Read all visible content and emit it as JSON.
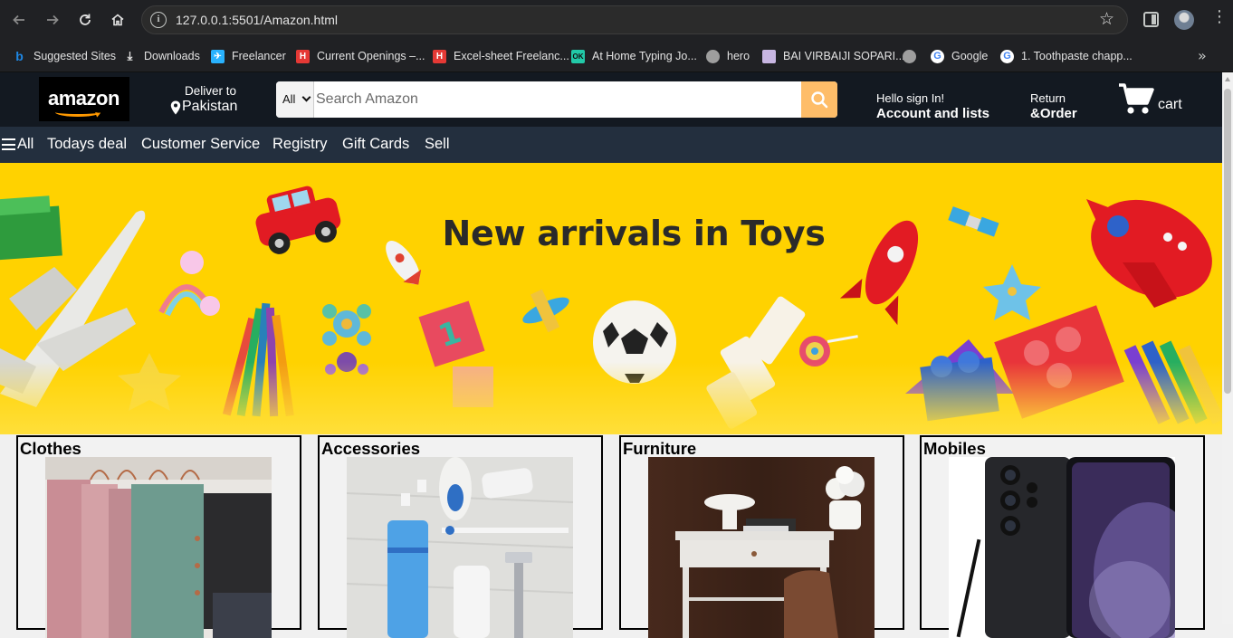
{
  "browser": {
    "url": "127.0.0.1:5501/Amazon.html",
    "back_icon": "arrow-left-icon",
    "forward_icon": "arrow-right-icon",
    "reload_icon": "reload-icon",
    "home_icon": "home-icon"
  },
  "bookmarks": [
    {
      "label": "Suggested Sites",
      "icon": "bing-icon",
      "color": "#1e88e5"
    },
    {
      "label": "Downloads",
      "icon": "download-icon",
      "color": "#e3e3e3"
    },
    {
      "label": "Freelancer",
      "icon": "freelancer-icon",
      "color": "#29b2fe"
    },
    {
      "label": "Current Openings –...",
      "icon": "h-icon",
      "color": "#e53935"
    },
    {
      "label": "Excel-sheet Freelanc...",
      "icon": "h-icon",
      "color": "#e53935"
    },
    {
      "label": "At Home Typing Jo...",
      "icon": "ok-icon",
      "color": "#22c9a8"
    },
    {
      "label": "hero",
      "icon": "globe-icon",
      "color": "#9e9e9e"
    },
    {
      "label": "BAI VIRBAIJI SOPARI...",
      "icon": "school-icon",
      "color": "#c8b6e2"
    },
    {
      "label": "",
      "icon": "globe-icon",
      "color": "#9e9e9e"
    },
    {
      "label": "Google",
      "icon": "google-icon",
      "color": "#ffffff"
    },
    {
      "label": "1. Toothpaste chapp...",
      "icon": "google-icon",
      "color": "#ffffff"
    }
  ],
  "header": {
    "logo_text": "amazon",
    "deliver_line1": "Deliver to",
    "deliver_line2": "Pakistan",
    "search_category": "All",
    "search_placeholder": "Search Amazon",
    "hello_line1": "Hello sign In!",
    "hello_line2": "Account and lists",
    "return_line1": "Return",
    "return_line2": "&Order",
    "cart_label": "cart"
  },
  "nav": {
    "all_label": "All",
    "items": [
      "Todays deal",
      "Customer Service",
      "Registry",
      "Gift Cards",
      "Sell"
    ]
  },
  "hero": {
    "title": "New arrivals in Toys",
    "background_color": "#ffd200"
  },
  "categories": [
    {
      "title": "Clothes"
    },
    {
      "title": "Accessories"
    },
    {
      "title": "Furniture"
    },
    {
      "title": "Mobiles"
    }
  ],
  "colors": {
    "header_bg": "#131921",
    "nav_bg": "#232f3e",
    "search_button": "#febd69",
    "logo_smile": "#ff9900"
  }
}
